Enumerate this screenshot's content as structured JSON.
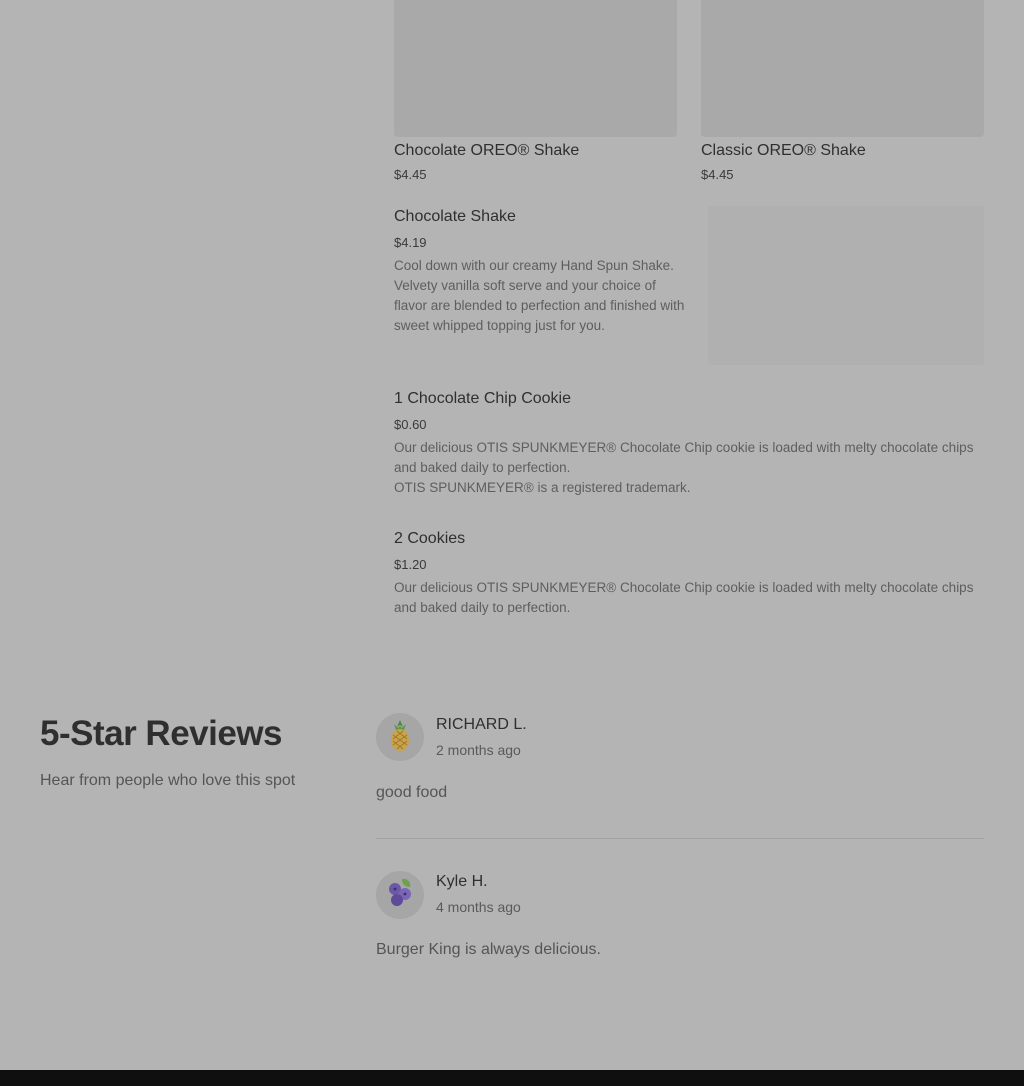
{
  "menu": {
    "items": [
      {
        "title": "Chocolate OREO® Shake",
        "price": "$4.45"
      },
      {
        "title": "Classic OREO® Shake",
        "price": "$4.45"
      },
      {
        "title": "Chocolate Shake",
        "price": "$4.19",
        "desc": "Cool down with our creamy Hand Spun Shake. Velvety vanilla soft serve and your choice of flavor are blended to perfection and finished with sweet whipped topping just for you."
      },
      {
        "title": "1 Chocolate Chip Cookie",
        "price": "$0.60",
        "desc": "Our delicious OTIS SPUNKMEYER® Chocolate Chip cookie is loaded with melty chocolate chips and baked daily to perfection.",
        "note": "OTIS SPUNKMEYER® is a registered trademark."
      },
      {
        "title": "2 Cookies",
        "price": "$1.20",
        "desc": "Our delicious OTIS SPUNKMEYER® Chocolate Chip cookie is loaded with melty chocolate chips and baked daily to perfection."
      }
    ]
  },
  "reviews": {
    "heading": "5-Star Reviews",
    "subheading": "Hear from people who love this spot",
    "list": [
      {
        "name": "RICHARD L.",
        "time": "2 months ago",
        "text": "good food",
        "avatar_icon": "pineapple-icon"
      },
      {
        "name": "Kyle H.",
        "time": "4 months ago",
        "text": "Burger King is always delicious.",
        "avatar_icon": "blueberries-icon"
      }
    ]
  },
  "colors": {
    "overlay_bg": "#b4b4b4",
    "footer": "#0f0f0f"
  }
}
